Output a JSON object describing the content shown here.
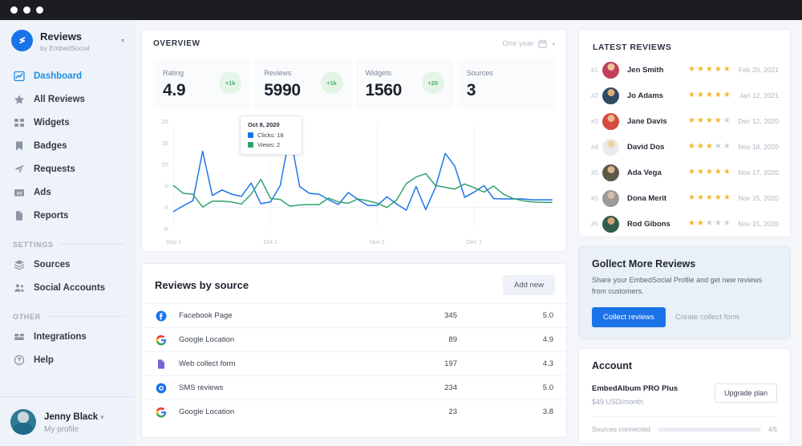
{
  "window": {
    "dots": 3
  },
  "sidebar": {
    "brand": {
      "title": "Reviews",
      "subtitle": "by EmbedSocial",
      "caret": "▾",
      "logo_icon": "embedsocial-logo-icon",
      "logo_color": "#1a73e8"
    },
    "nav": [
      {
        "label": "Dashboard",
        "icon": "chart-line-icon",
        "active": true
      },
      {
        "label": "All Reviews",
        "icon": "star-icon",
        "active": false
      },
      {
        "label": "Widgets",
        "icon": "grid-icon",
        "active": false
      },
      {
        "label": "Badges",
        "icon": "bookmark-icon",
        "active": false
      },
      {
        "label": "Requests",
        "icon": "paper-plane-icon",
        "active": false
      },
      {
        "label": "Ads",
        "icon": "ad-icon",
        "active": false
      },
      {
        "label": "Reports",
        "icon": "document-icon",
        "active": false
      }
    ],
    "sections": [
      {
        "label": "SETTINGS",
        "items": [
          {
            "label": "Sources",
            "icon": "layers-icon"
          },
          {
            "label": "Social Accounts",
            "icon": "users-icon"
          }
        ]
      },
      {
        "label": "OTHER",
        "items": [
          {
            "label": "Integrations",
            "icon": "puzzle-icon"
          },
          {
            "label": "Help",
            "icon": "question-circle-icon"
          }
        ]
      }
    ],
    "profile": {
      "name": "Jenny Black",
      "subtitle": "My profile",
      "caret": "▾",
      "avatar_icon": "user-avatar"
    }
  },
  "overview": {
    "title": "OVERVIEW",
    "range_label": "One year",
    "calendar_icon": "calendar-icon",
    "caret": "▾",
    "stats": [
      {
        "label": "Rating",
        "value": "4.9",
        "badge": "+1k"
      },
      {
        "label": "Reviews",
        "value": "5990",
        "badge": "+1k"
      },
      {
        "label": "Widgets",
        "value": "1560",
        "badge": "+20"
      },
      {
        "label": "Sources",
        "value": "3",
        "badge": ""
      }
    ],
    "tooltip": {
      "date": "Oct 8, 2020",
      "rows": [
        {
          "label": "Clicks: 18",
          "color": "#1a73e8"
        },
        {
          "label": "Views: 2",
          "color": "#2fa36b"
        }
      ]
    }
  },
  "chart_data": {
    "type": "line",
    "title": "",
    "xlabel": "",
    "ylabel": "",
    "ylim": [
      -5,
      20
    ],
    "yticks": [
      20,
      15,
      10,
      5,
      0,
      -5
    ],
    "xticks": [
      "Sep 1",
      "Oct 1",
      "Nov 1",
      "Dec 1"
    ],
    "xtick_positions": [
      0,
      10,
      21,
      31
    ],
    "grid": true,
    "legend_position": "tooltip",
    "x": [
      0,
      1,
      2,
      3,
      4,
      5,
      6,
      7,
      8,
      9,
      10,
      11,
      12,
      13,
      14,
      15,
      16,
      17,
      18,
      19,
      20,
      21,
      22,
      23,
      24,
      25,
      26,
      27,
      28,
      29,
      30,
      31,
      32,
      33,
      34,
      35,
      36,
      37,
      38,
      39
    ],
    "series": [
      {
        "name": "Clicks",
        "color": "#1a73e8",
        "values": [
          -1,
          0.3,
          1.5,
          13,
          2.7,
          4,
          3,
          2.5,
          5.6,
          0.8,
          1.2,
          5,
          17,
          4.8,
          3.2,
          3,
          1.7,
          0.6,
          3.4,
          1.8,
          0.4,
          0.4,
          2.4,
          0.7,
          -0.7,
          4.8,
          -0.6,
          4.6,
          12.5,
          9.5,
          2.3,
          3.5,
          5,
          2,
          1.9,
          1.9,
          1.9,
          1.7,
          1.7,
          1.7
        ]
      },
      {
        "name": "Views",
        "color": "#2fa36b",
        "values": [
          5,
          3.2,
          3,
          0,
          1.4,
          1.4,
          1.2,
          0.7,
          3,
          6.5,
          2,
          1.8,
          0.2,
          0.5,
          0.6,
          0.6,
          2.1,
          1.2,
          0.9,
          1.9,
          1.5,
          0.9,
          -0.1,
          1.7,
          5.5,
          7,
          7.8,
          5,
          4.6,
          4.2,
          5.4,
          4.5,
          3.5,
          4.9,
          3,
          2,
          1.5,
          1.2,
          1.1,
          1.1
        ]
      }
    ]
  },
  "latest_reviews": {
    "title": "LATEST REVIEWS",
    "items": [
      {
        "rank": "#1",
        "name": "Jen Smith",
        "stars": 5,
        "date": "Feb 20, 2021",
        "avatar_color": "#c0405c",
        "skin": "#f0c39a"
      },
      {
        "rank": "#2",
        "name": "Jo Adams",
        "stars": 5,
        "date": "Jan 12, 2021",
        "avatar_color": "#2f4a63",
        "skin": "#e2ad7d"
      },
      {
        "rank": "#3",
        "name": "Jane Davis",
        "stars": 4,
        "date": "Dec 12, 2020",
        "avatar_color": "#d64a3e",
        "skin": "#e8bb93"
      },
      {
        "rank": "#4",
        "name": "David Dos",
        "stars": 3,
        "date": "Nov 18, 2020",
        "avatar_color": "#e9eaec",
        "skin": "#f2cfa6"
      },
      {
        "rank": "#5",
        "name": "Ada Vega",
        "stars": 5,
        "date": "Nov 17, 2020",
        "avatar_color": "#5c5a47",
        "skin": "#d9b48c"
      },
      {
        "rank": "#5",
        "name": "Dona Merit",
        "stars": 5,
        "date": "Nov 15, 2020",
        "avatar_color": "#9a9a96",
        "skin": "#d8c0a6"
      },
      {
        "rank": "#5",
        "name": "Rod Gibons",
        "stars": 2,
        "date": "Nov 15, 2020",
        "avatar_color": "#2f5f4a",
        "skin": "#d9a071"
      }
    ],
    "star_on_color": "#f5b62f",
    "star_off_color": "#c9cfd9",
    "star_glyph": "★"
  },
  "reviews_by_source": {
    "title": "Reviews by source",
    "add_new_label": "Add new",
    "rows": [
      {
        "name": "Facebook Page",
        "count": "345",
        "rating": "5.0",
        "icon": "facebook-icon"
      },
      {
        "name": "Google Location",
        "count": "89",
        "rating": "4.9",
        "icon": "google-icon"
      },
      {
        "name": "Web collect form",
        "count": "197",
        "rating": "4.3",
        "icon": "file-icon"
      },
      {
        "name": "SMS reviews",
        "count": "234",
        "rating": "5.0",
        "icon": "sms-icon"
      },
      {
        "name": "Google Location",
        "count": "23",
        "rating": "3.8",
        "icon": "google-icon"
      }
    ]
  },
  "collect_card": {
    "title": "Gollect More Reviews",
    "text": "Share your EmbedSocial Profile and get new reviews from customers.",
    "primary_label": "Collect reviews",
    "secondary_label": "Create collect form",
    "primary_color": "#1a73e8"
  },
  "account": {
    "title": "Account",
    "plan": "EmbedAlbum PRO Plus",
    "price": "$49 USD/month",
    "upgrade_label": "Upgrade plan",
    "progress_label": "Sources connected",
    "progress_count": "4/5",
    "progress_percent": 80,
    "progress_color": "#1a73e8"
  }
}
